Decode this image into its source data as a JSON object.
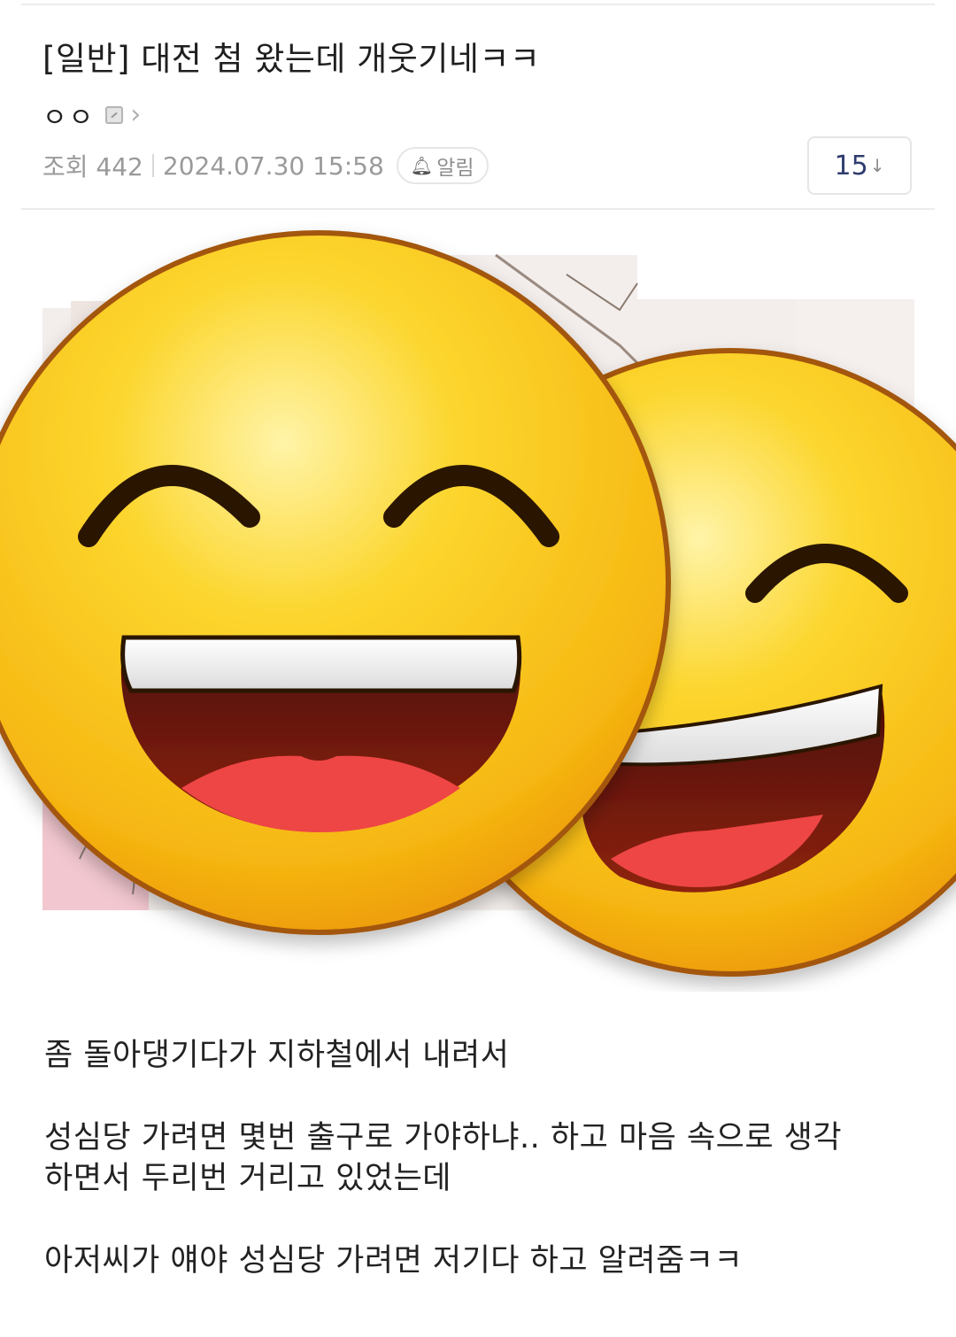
{
  "post": {
    "title": "[일반] 대전 첨 왔는데 개웃기네ㅋㅋ",
    "author": "ㅇㅇ",
    "views_label": "조회 442",
    "datetime": "2024.07.30 15:58",
    "alarm_label": "알림",
    "comment_count": "15",
    "comment_arrow": "↓"
  },
  "icons": {
    "level": "level-badge-icon",
    "chevron": "chevron-right-icon",
    "bell": "bell-icon"
  },
  "colors": {
    "emoji_face": "#f9c21c",
    "emoji_outline": "#a3560a",
    "mouth": "#5a1206",
    "tongue": "#f04a4a",
    "comment_count": "#2f3c6e"
  },
  "content": {
    "lines": [
      "좀 돌아댕기다가 지하철에서 내려서",
      "성심당 가려면 몇번 출구로 가야하냐.. 하고 마음 속으로 생각",
      "하면서 두리번 거리고 있었는데",
      "아저씨가 얘야 성심당 가려면 저기다 하고 알려줌ㅋㅋ"
    ]
  }
}
